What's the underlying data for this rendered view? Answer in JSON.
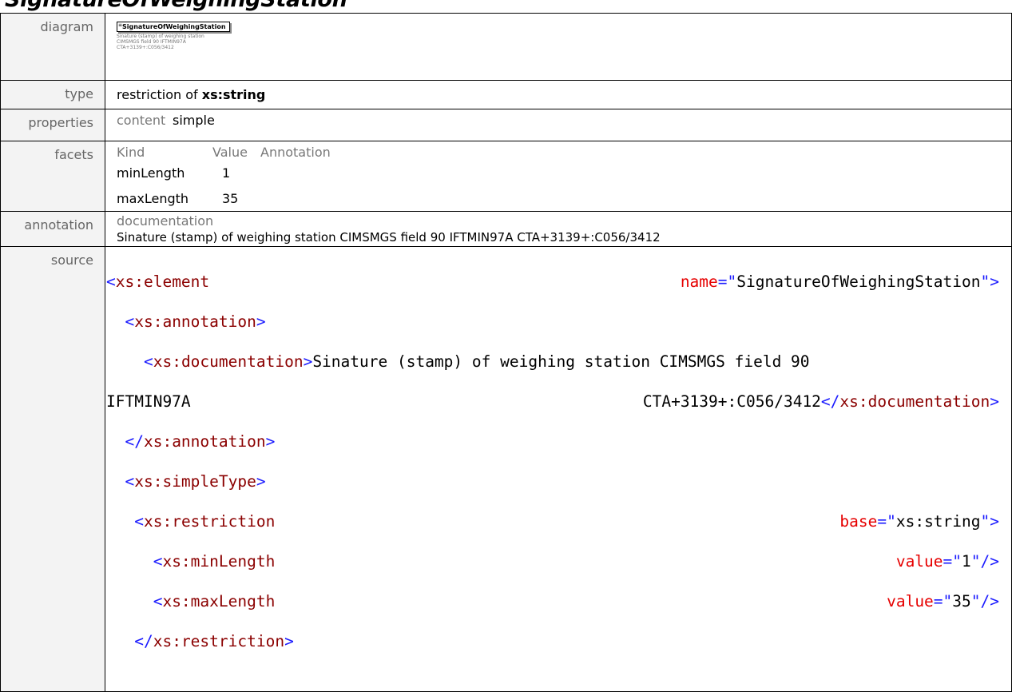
{
  "title_partial": "SignatureOfWeighingStation",
  "labels": {
    "diagram": "diagram",
    "type": "type",
    "properties": "properties",
    "facets": "facets",
    "annotation": "annotation",
    "source": "source"
  },
  "diagram": {
    "element_name": "SignatureOfWeighingStation",
    "note_lines": [
      "Sinature (stamp) of weighing station",
      "CIMSMGS field 90 IFTMIN97A",
      "CTA+3139+:C056/3412"
    ]
  },
  "type": {
    "prefix": "restriction of",
    "base": "xs:string"
  },
  "properties": {
    "key": "content",
    "value": "simple"
  },
  "facets": {
    "headers": [
      "Kind",
      "Value",
      "Annotation"
    ],
    "rows": [
      {
        "kind": "minLength",
        "value": "1"
      },
      {
        "kind": "maxLength",
        "value": "35"
      }
    ]
  },
  "annotation": {
    "heading": "documentation",
    "text": "Sinature (stamp) of weighing station CIMSMGS field 90 IFTMIN97A CTA+3139+:C056/3412"
  },
  "source": {
    "element_tag": "xs:element",
    "element_name_attr": "name",
    "element_name_value": "SignatureOfWeighingStation",
    "annotation_tag": "xs:annotation",
    "documentation_tag": "xs:documentation",
    "doc_text_1": "Sinature (stamp) of weighing station CIMSMGS field 90",
    "doc_text_2a": "IFTMIN97A",
    "doc_text_2b": "CTA+3139+:C056/3412",
    "simpletype_tag": "xs:simpleType",
    "restriction_tag": "xs:restriction",
    "base_attr": "base",
    "base_value": "xs:string",
    "minlength_tag": "xs:minLength",
    "maxlength_tag": "xs:maxLength",
    "value_attr": "value",
    "min_value": "1",
    "max_value": "35"
  }
}
